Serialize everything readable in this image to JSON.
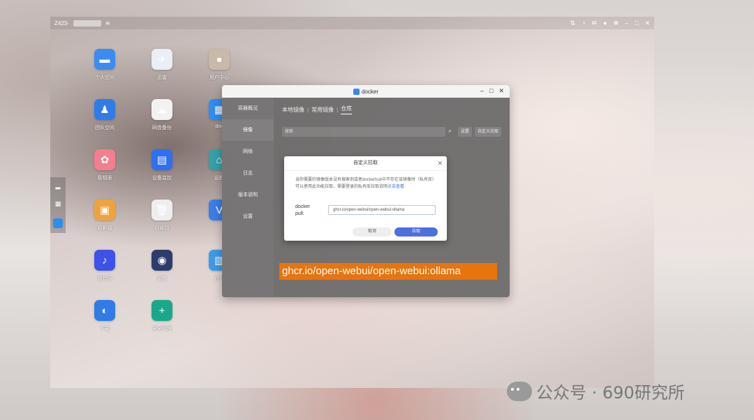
{
  "topbar": {
    "device_label": "Z423-"
  },
  "desktop_apps": [
    {
      "label": "个人空间",
      "color": "#3c8cf0",
      "icon": "folder-icon",
      "glyph": "▬"
    },
    {
      "label": "迅雷",
      "color": "#e9eef7",
      "icon": "bird-icon",
      "glyph": "✈"
    },
    {
      "label": "用户中心",
      "color": "#c9b9a8",
      "icon": "user-icon",
      "glyph": "●"
    },
    {
      "label": "团队空间",
      "color": "#2f7ce8",
      "icon": "team-icon",
      "glyph": "♟"
    },
    {
      "label": "网盘备份",
      "color": "#f2f2f2",
      "icon": "cloud-download-icon",
      "glyph": "☁"
    },
    {
      "label": "doc",
      "color": "#2f8cf0",
      "icon": "docker-icon",
      "glyph": "▦"
    },
    {
      "label": "极相册",
      "color": "#f47f8c",
      "icon": "photos-icon",
      "glyph": "✿"
    },
    {
      "label": "设备监控",
      "color": "#2f6ff0",
      "icon": "monitor-chart-icon",
      "glyph": "▤"
    },
    {
      "label": "远程",
      "color": "#34a0a8",
      "icon": "remote-icon",
      "glyph": "⌂"
    },
    {
      "label": "极影视",
      "color": "#f0a23c",
      "icon": "film-icon",
      "glyph": "▣"
    },
    {
      "label": "回收站",
      "color": "#eeeeee",
      "icon": "trash-icon",
      "glyph": "🗑"
    },
    {
      "label": "",
      "color": "#3c7de8",
      "icon": "v-app-icon",
      "glyph": "V"
    },
    {
      "label": "极音乐",
      "color": "#3c52e8",
      "icon": "music-icon",
      "glyph": "♪"
    },
    {
      "label": "系统",
      "color": "#2d3c6b",
      "icon": "system-icon",
      "glyph": "◉"
    },
    {
      "label": "存储",
      "color": "#3c9be8",
      "icon": "storage-icon",
      "glyph": "▥"
    },
    {
      "label": "下载",
      "color": "#2f7ce8",
      "icon": "globe-download-icon",
      "glyph": "◐"
    },
    {
      "label": "安全管理",
      "color": "#1aa88a",
      "icon": "shield-plus-icon",
      "glyph": "+"
    }
  ],
  "docker_window": {
    "title": "docker",
    "sidebar": [
      "容器概况",
      "镜像",
      "网络",
      "日志",
      "版本说明",
      "设置"
    ],
    "active_sidebar": "镜像",
    "tabs": [
      "本地镜像",
      "常用镜像",
      "仓库"
    ],
    "active_tab": "仓库",
    "search_placeholder": "搜索",
    "settings_label": "设置",
    "custom_pull_label": "自定义拉取"
  },
  "dialog": {
    "title": "自定义拉取",
    "description": "当你需要的镜像版本没有搜索到或者dockerhub中不存在该镜像时（私有库）可以使用此功能拉取，需要登录的私有库拉取说明",
    "link_text": "点击查看",
    "label_line1": "docker",
    "label_line2": "pull:",
    "input_value": "ghcr.io/open-webui/open-webui:ollama",
    "cancel": "取消",
    "ok": "拉取"
  },
  "highlight_text": "ghcr.io/open-webui/open-webui:ollama",
  "watermark": "公众号 · 690研究所"
}
